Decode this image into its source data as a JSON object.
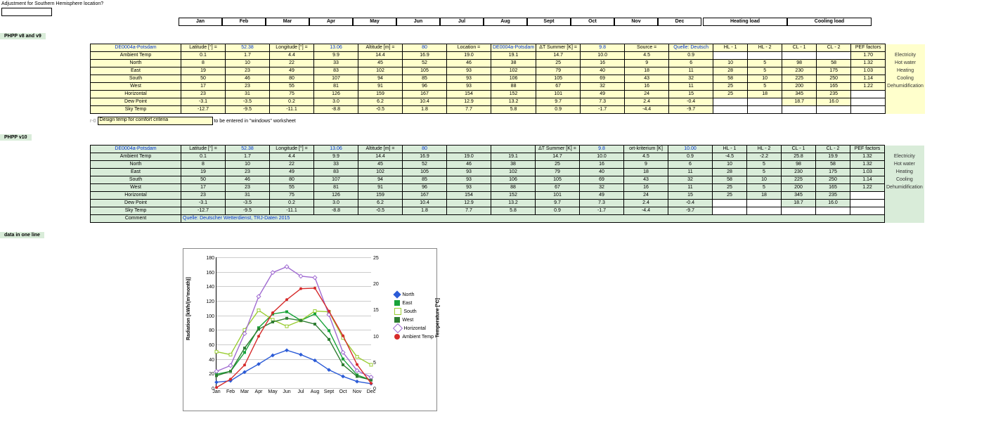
{
  "top": {
    "adjust_label": "Adjustment for Southern Hemisphere location?"
  },
  "months": [
    "Jan",
    "Feb",
    "Mar",
    "Apr",
    "May",
    "Jun",
    "Jul",
    "Aug",
    "Sept",
    "Oct",
    "Nov",
    "Dec"
  ],
  "load_headers": [
    "Heating load",
    "Cooling load"
  ],
  "sections": {
    "v8v9": "PHPP v8 and v9",
    "v10": "PHPP v10",
    "data1": "data in one line"
  },
  "meta_labels": {
    "lat": "Latitude [°] =",
    "lon": "Longitude [°] =",
    "alt": "Altitude [m] =",
    "loc": "Location =",
    "dts": "ΔT Summer [K] =",
    "src": "Source =",
    "ortk": "ort-kriterium [K]",
    "hl1": "HL - 1",
    "hl2": "HL - 2",
    "cl1": "CL - 1",
    "cl2": "CL - 2",
    "pef": "PEF factors"
  },
  "meta_vals": {
    "code": "DE0004a-Potsdam",
    "lat": "52.38",
    "lon": "13.06",
    "alt": "80",
    "loc": "DE0004a-Potsdam",
    "dts": "9.8",
    "src": "Quelle: Deutsch",
    "ortk": "10.00"
  },
  "pef_side": [
    "Electricity",
    "Hot water",
    "Heating",
    "Cooling",
    "Dehumidification"
  ],
  "rows_v8": [
    {
      "n": "Ambient Temp",
      "v": [
        "0.1",
        "1.7",
        "4.4",
        "9.9",
        "14.4",
        "16.9",
        "19.0",
        "19.1",
        "14.7",
        "10.0",
        "4.5",
        "0.9"
      ],
      "hl": [
        "",
        "",
        "",
        ""
      ],
      "pef": "1.70"
    },
    {
      "n": "North",
      "v": [
        "8",
        "10",
        "22",
        "33",
        "45",
        "52",
        "46",
        "38",
        "25",
        "16",
        "9",
        "6"
      ],
      "hl": [
        "10",
        "5",
        "98",
        "58"
      ],
      "pef": "1.32"
    },
    {
      "n": "East",
      "v": [
        "19",
        "23",
        "49",
        "83",
        "102",
        "105",
        "93",
        "102",
        "79",
        "40",
        "18",
        "11"
      ],
      "hl": [
        "28",
        "5",
        "230",
        "175"
      ],
      "pef": "1.03"
    },
    {
      "n": "South",
      "v": [
        "50",
        "46",
        "80",
        "107",
        "94",
        "85",
        "93",
        "106",
        "105",
        "69",
        "43",
        "32"
      ],
      "hl": [
        "58",
        "10",
        "225",
        "250"
      ],
      "pef": "1.14"
    },
    {
      "n": "West",
      "v": [
        "17",
        "23",
        "55",
        "81",
        "91",
        "96",
        "93",
        "88",
        "67",
        "32",
        "16",
        "11"
      ],
      "hl": [
        "25",
        "5",
        "200",
        "165"
      ],
      "pef": "1.22"
    },
    {
      "n": "Horizontal",
      "v": [
        "23",
        "31",
        "75",
        "126",
        "159",
        "167",
        "154",
        "152",
        "101",
        "49",
        "24",
        "15"
      ],
      "hl": [
        "25",
        "18",
        "345",
        "235"
      ],
      "pef": ""
    },
    {
      "n": "Dew Point",
      "v": [
        "-3.1",
        "-3.5",
        "0.2",
        "3.0",
        "6.2",
        "10.4",
        "12.9",
        "13.2",
        "9.7",
        "7.3",
        "2.4",
        "-0.4"
      ],
      "hl": [
        "",
        "",
        "18.7",
        "16.0"
      ],
      "pef": ""
    },
    {
      "n": "Sky Temp",
      "v": [
        "-12.7",
        "-9.5",
        "-11.1",
        "-8.8",
        "-0.5",
        "1.8",
        "7.7",
        "5.8",
        "0.9",
        "-1.7",
        "-4.4",
        "-9.7"
      ],
      "hl": [
        "",
        "",
        "",
        ""
      ],
      "pef": ""
    }
  ],
  "rows_v10": [
    {
      "n": "Ambient Temp",
      "v": [
        "0.1",
        "1.7",
        "4.4",
        "9.9",
        "14.4",
        "16.9",
        "19.0",
        "19.1",
        "14.7",
        "10.0",
        "4.5",
        "0.9"
      ],
      "hl": [
        "-4.5",
        "-2.2",
        "25.8",
        "19.9"
      ],
      "pef": "1.32"
    },
    {
      "n": "North",
      "v": [
        "8",
        "10",
        "22",
        "33",
        "45",
        "52",
        "46",
        "38",
        "25",
        "16",
        "9",
        "6"
      ],
      "hl": [
        "10",
        "5",
        "98",
        "58"
      ],
      "pef": "1.32"
    },
    {
      "n": "East",
      "v": [
        "19",
        "23",
        "49",
        "83",
        "102",
        "105",
        "93",
        "102",
        "79",
        "40",
        "18",
        "11"
      ],
      "hl": [
        "28",
        "5",
        "230",
        "175"
      ],
      "pef": "1.03"
    },
    {
      "n": "South",
      "v": [
        "50",
        "46",
        "80",
        "107",
        "94",
        "85",
        "93",
        "106",
        "105",
        "69",
        "43",
        "32"
      ],
      "hl": [
        "58",
        "10",
        "225",
        "250"
      ],
      "pef": "1.14"
    },
    {
      "n": "West",
      "v": [
        "17",
        "23",
        "55",
        "81",
        "91",
        "96",
        "93",
        "88",
        "67",
        "32",
        "16",
        "11"
      ],
      "hl": [
        "25",
        "5",
        "200",
        "165"
      ],
      "pef": "1.22"
    },
    {
      "n": "Horizontal",
      "v": [
        "23",
        "31",
        "75",
        "126",
        "159",
        "167",
        "154",
        "152",
        "101",
        "49",
        "24",
        "15"
      ],
      "hl": [
        "25",
        "18",
        "345",
        "235"
      ],
      "pef": ""
    },
    {
      "n": "Dew Point",
      "v": [
        "-3.1",
        "-3.5",
        "0.2",
        "3.0",
        "6.2",
        "10.4",
        "12.9",
        "13.2",
        "9.7",
        "7.3",
        "2.4",
        "-0.4"
      ],
      "hl": [
        "",
        "",
        "18.7",
        "16.0"
      ],
      "pef": ""
    },
    {
      "n": "Sky Temp",
      "v": [
        "-12.7",
        "-9.5",
        "-11.1",
        "-8.8",
        "-0.5",
        "1.8",
        "7.7",
        "5.8",
        "0.9",
        "-1.7",
        "-4.4",
        "-9.7"
      ],
      "hl": [
        "",
        "",
        "",
        ""
      ],
      "pef": ""
    },
    {
      "n": "Comment",
      "v": [
        "Quelle: Deutscher Wetterdienst, TRJ-Daten 2015",
        "",
        "",
        "",
        "",
        "",
        "",
        "",
        "",
        "",
        "",
        ""
      ],
      "hl": [
        "",
        "",
        "",
        ""
      ],
      "pef": ""
    }
  ],
  "design_note": {
    "label": "Design temp for comfort criteria",
    "hint": "to be entered in \"windows\" worksheet"
  },
  "chart_data": {
    "type": "line",
    "x": [
      "Jan",
      "Feb",
      "Mar",
      "Apr",
      "May",
      "Jun",
      "Jul",
      "Aug",
      "Sept",
      "Oct",
      "Nov",
      "Dec"
    ],
    "y1label": "Radiation [kWh/(m²month)]",
    "y2label": "Temperature [°C]",
    "y1lim": [
      0,
      180
    ],
    "y2lim": [
      0,
      25
    ],
    "series": [
      {
        "name": "North",
        "axis": "y1",
        "color": "#2b5bd7",
        "marker": "diamond",
        "values": [
          8,
          10,
          22,
          33,
          45,
          52,
          46,
          38,
          25,
          16,
          9,
          6
        ]
      },
      {
        "name": "East",
        "axis": "y1",
        "color": "#19a33a",
        "marker": "square",
        "values": [
          19,
          23,
          49,
          83,
          102,
          105,
          93,
          102,
          79,
          40,
          18,
          11
        ]
      },
      {
        "name": "South",
        "axis": "y1",
        "color": "#9acd32",
        "marker": "square-open",
        "values": [
          50,
          46,
          80,
          107,
          94,
          85,
          93,
          106,
          105,
          69,
          43,
          32
        ]
      },
      {
        "name": "West",
        "axis": "y1",
        "color": "#2e7d32",
        "marker": "triangle",
        "values": [
          17,
          23,
          55,
          81,
          91,
          96,
          93,
          88,
          67,
          32,
          16,
          11
        ]
      },
      {
        "name": "Horizontal",
        "axis": "y1",
        "color": "#a06bd1",
        "marker": "diamond-open",
        "values": [
          23,
          31,
          75,
          126,
          159,
          167,
          154,
          152,
          101,
          49,
          24,
          15
        ]
      },
      {
        "name": "Ambient Temp",
        "axis": "y2",
        "color": "#d62b2b",
        "marker": "circle",
        "values": [
          0.1,
          1.7,
          4.4,
          9.9,
          14.4,
          16.9,
          19.0,
          19.1,
          14.7,
          10.0,
          4.5,
          0.9
        ]
      }
    ]
  }
}
